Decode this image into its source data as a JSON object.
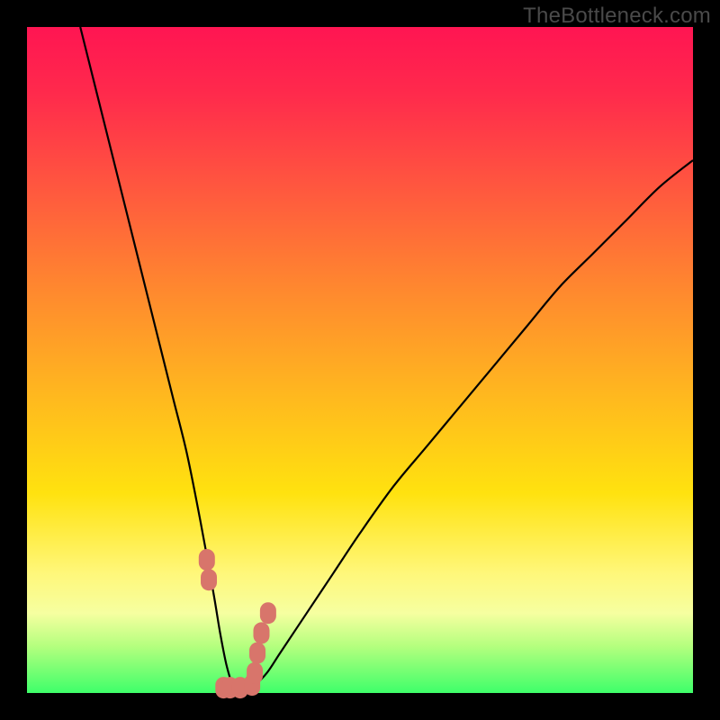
{
  "watermark": "TheBottleneck.com",
  "colors": {
    "frame": "#000000",
    "curve": "#000000",
    "marker_fill": "#d8756b",
    "marker_stroke": "#d8756b"
  },
  "chart_data": {
    "type": "line",
    "title": "",
    "xlabel": "",
    "ylabel": "",
    "xlim": [
      0,
      100
    ],
    "ylim": [
      0,
      100
    ],
    "grid": false,
    "legend": false,
    "background_gradient": [
      "#ff1552",
      "#ff5a3e",
      "#ffb71f",
      "#fff77a",
      "#3eff6a"
    ],
    "series": [
      {
        "name": "bottleneck-curve",
        "x": [
          8,
          10,
          12,
          14,
          16,
          18,
          20,
          22,
          24,
          26,
          28,
          29,
          30,
          31,
          32,
          33,
          34,
          36,
          38,
          42,
          46,
          50,
          55,
          60,
          65,
          70,
          75,
          80,
          85,
          90,
          95,
          100
        ],
        "values": [
          100,
          92,
          84,
          76,
          68,
          60,
          52,
          44,
          36,
          26,
          15,
          9,
          4,
          1,
          0.5,
          0.5,
          1,
          3,
          6,
          12,
          18,
          24,
          31,
          37,
          43,
          49,
          55,
          61,
          66,
          71,
          76,
          80
        ]
      }
    ],
    "markers": {
      "name": "trough-markers",
      "x": [
        27.0,
        27.3,
        29.5,
        30.5,
        32.0,
        33.8,
        34.2,
        34.6,
        35.2,
        36.2
      ],
      "values": [
        20.0,
        17.0,
        0.8,
        0.8,
        0.8,
        1.2,
        3.0,
        6.0,
        9.0,
        12.0
      ]
    }
  }
}
